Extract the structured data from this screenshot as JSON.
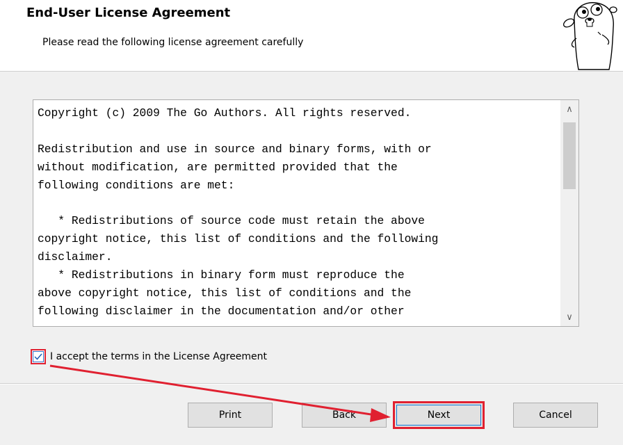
{
  "header": {
    "title": "End-User License Agreement",
    "subtitle": "Please read the following license agreement carefully"
  },
  "license": {
    "text": "Copyright (c) 2009 The Go Authors. All rights reserved.\n\nRedistribution and use in source and binary forms, with or\nwithout modification, are permitted provided that the\nfollowing conditions are met:\n\n   * Redistributions of source code must retain the above\ncopyright notice, this list of conditions and the following\ndisclaimer.\n   * Redistributions in binary form must reproduce the\nabove copyright notice, this list of conditions and the\nfollowing disclaimer in the documentation and/or other"
  },
  "accept": {
    "checked": true,
    "label": "I accept the terms in the License Agreement"
  },
  "buttons": {
    "print": "Print",
    "back": "Back",
    "next": "Next",
    "cancel": "Cancel"
  },
  "colors": {
    "annotation": "#e02030",
    "focus": "#0b78d7"
  },
  "icons": {
    "mascot": "go-gopher-icon",
    "check": "checkmark-icon",
    "scroll_up": "chevron-up-icon",
    "scroll_down": "chevron-down-icon"
  }
}
